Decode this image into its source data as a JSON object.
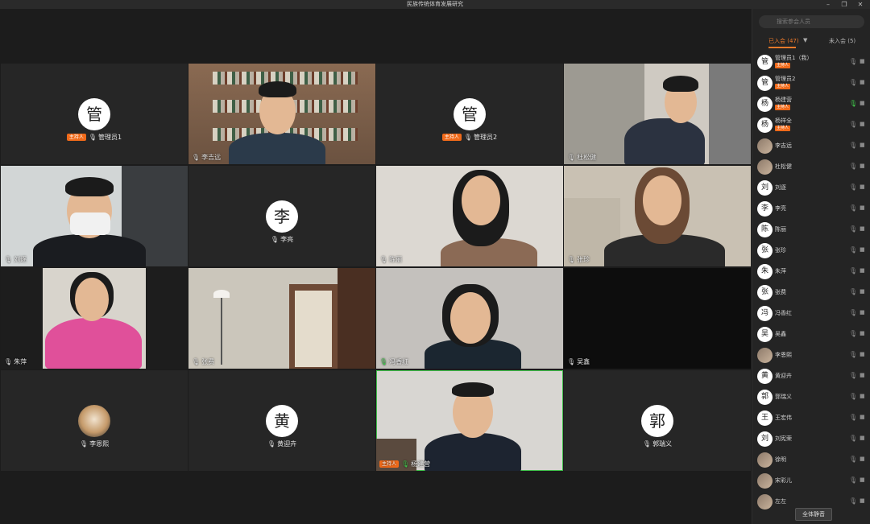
{
  "window": {
    "title": "民族传统体育发展研究",
    "controls": {
      "minimize": "–",
      "maximize": "❐",
      "close": "✕"
    }
  },
  "tiles": [
    {
      "name": "管理员1",
      "avatar": "管",
      "type": "avatar",
      "host": "主持人",
      "mic": "off"
    },
    {
      "name": "李吉远",
      "type": "video",
      "mic": "off"
    },
    {
      "name": "管理员2",
      "avatar": "管",
      "type": "avatar",
      "host": "主持人",
      "mic": "off"
    },
    {
      "name": "杜松健",
      "type": "video",
      "mic": "off"
    },
    {
      "name": "刘逐",
      "type": "video",
      "mic": "off"
    },
    {
      "name": "李亮",
      "avatar": "李",
      "type": "avatar",
      "mic": "off"
    },
    {
      "name": "陈丽",
      "type": "video",
      "mic": "off"
    },
    {
      "name": "张珍",
      "type": "video",
      "mic": "off"
    },
    {
      "name": "朱萍",
      "type": "video",
      "mic": "off"
    },
    {
      "name": "张费",
      "type": "video",
      "mic": "off"
    },
    {
      "name": "冯香红",
      "type": "video",
      "mic": "on"
    },
    {
      "name": "吴鑫",
      "type": "dark",
      "mic": "off"
    },
    {
      "name": "李恩熙",
      "type": "avatar-photo",
      "mic": "off"
    },
    {
      "name": "黄迎卉",
      "avatar": "黄",
      "type": "avatar",
      "mic": "off"
    },
    {
      "name": "杨建营",
      "type": "video",
      "host": "主持人",
      "mic": "on",
      "active": true
    },
    {
      "name": "郭瑞义",
      "avatar": "郭",
      "type": "avatar",
      "mic": "off"
    }
  ],
  "sidebar": {
    "search_placeholder": "搜索参会人员",
    "tab_joined": "已入会 (47)",
    "tab_not_joined": "未入会 (5)",
    "host_badge": "主持人",
    "participants": [
      {
        "avatar": "管",
        "name": "管理员1（我）",
        "host": true,
        "mic": "off"
      },
      {
        "avatar": "管",
        "name": "管理员2",
        "host": true,
        "mic": "off"
      },
      {
        "avatar": "杨",
        "name": "杨建营",
        "host": true,
        "mic": "on"
      },
      {
        "avatar": "杨",
        "name": "杨祥全",
        "host": true,
        "mic": "off"
      },
      {
        "avatar": "",
        "photo": true,
        "name": "李吉远",
        "mic": "off"
      },
      {
        "avatar": "",
        "photo": true,
        "name": "杜松健",
        "mic": "off"
      },
      {
        "avatar": "刘",
        "name": "刘逐",
        "mic": "off"
      },
      {
        "avatar": "李",
        "name": "李亮",
        "mic": "off"
      },
      {
        "avatar": "陈",
        "name": "陈丽",
        "mic": "off"
      },
      {
        "avatar": "张",
        "name": "张珍",
        "mic": "off"
      },
      {
        "avatar": "朱",
        "name": "朱萍",
        "mic": "off"
      },
      {
        "avatar": "张",
        "name": "张费",
        "mic": "off"
      },
      {
        "avatar": "冯",
        "name": "冯香红",
        "mic": "off"
      },
      {
        "avatar": "吴",
        "name": "吴鑫",
        "mic": "off"
      },
      {
        "avatar": "",
        "photo": true,
        "name": "李恩熙",
        "mic": "off"
      },
      {
        "avatar": "黄",
        "name": "黄迎卉",
        "mic": "off"
      },
      {
        "avatar": "郭",
        "name": "郭瑞义",
        "mic": "off"
      },
      {
        "avatar": "王",
        "name": "王宏伟",
        "mic": "off"
      },
      {
        "avatar": "刘",
        "name": "刘宪荣",
        "mic": "off"
      },
      {
        "avatar": "",
        "photo": true,
        "name": "徐明",
        "mic": "off"
      },
      {
        "avatar": "",
        "photo": true,
        "name": "宋彩儿",
        "mic": "off"
      },
      {
        "avatar": "",
        "photo": true,
        "name": "左左",
        "mic": "off"
      }
    ],
    "mute_all": "全体静音"
  },
  "colors": {
    "accent": "#f07a2a",
    "mic_on": "#40c34a",
    "background": "#1f1f1f"
  }
}
